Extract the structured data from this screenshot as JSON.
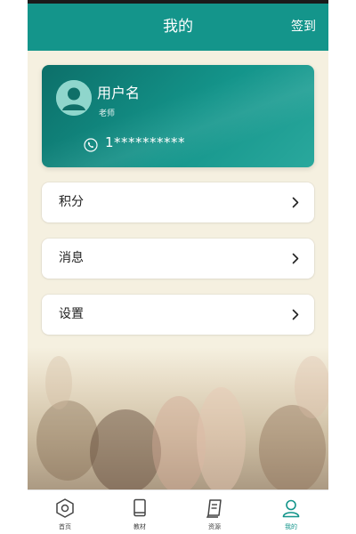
{
  "header": {
    "title": "我的",
    "signin_label": "签到"
  },
  "profile": {
    "username": "用户名",
    "role": "老师",
    "phone": "1**********",
    "avatar_icon": "user-avatar-icon",
    "phone_icon": "phone-icon"
  },
  "menu": [
    {
      "label": "积分",
      "icon": "chevron-right-icon"
    },
    {
      "label": "消息",
      "icon": "chevron-right-icon"
    },
    {
      "label": "设置",
      "icon": "chevron-right-icon"
    }
  ],
  "tabbar": [
    {
      "label": "首页",
      "icon": "home-hexagon-icon",
      "active": false
    },
    {
      "label": "教材",
      "icon": "book-icon",
      "active": false
    },
    {
      "label": "资源",
      "icon": "resource-book-icon",
      "active": false
    },
    {
      "label": "我的",
      "icon": "user-icon",
      "active": true
    }
  ],
  "colors": {
    "accent": "#14958b",
    "page_background": "#f5f0e0",
    "card_gradient_start": "#0c6f69",
    "card_gradient_end": "#2aa89d"
  }
}
